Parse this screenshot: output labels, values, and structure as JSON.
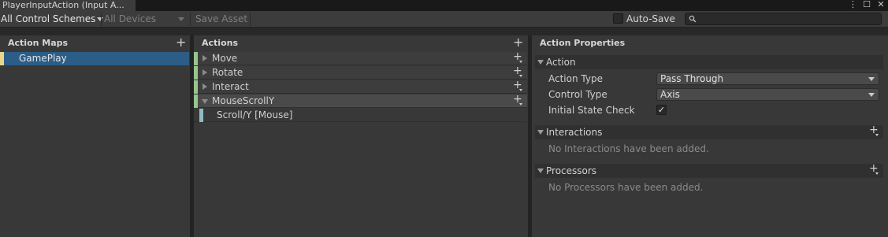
{
  "window": {
    "tab_title": "PlayerInputAction (Input A...",
    "icons": [
      "more-icon",
      "maximize-icon",
      "close-icon"
    ]
  },
  "toolbar": {
    "control_schemes": "All Control Schemes",
    "devices": "All Devices",
    "save_asset": "Save Asset",
    "auto_save_label": "Auto-Save",
    "auto_save_checked": false,
    "search_placeholder": ""
  },
  "action_maps": {
    "header": "Action Maps",
    "items": [
      {
        "label": "GamePlay",
        "selected": true
      }
    ]
  },
  "actions": {
    "header": "Actions",
    "items": [
      {
        "label": "Move",
        "expanded": false
      },
      {
        "label": "Rotate",
        "expanded": false
      },
      {
        "label": "Interact",
        "expanded": false
      },
      {
        "label": "MouseScrollY",
        "expanded": true,
        "selected": true
      }
    ],
    "bindings": [
      {
        "label": "Scroll/Y [Mouse]"
      }
    ]
  },
  "properties": {
    "header": "Action Properties",
    "action_section": "Action",
    "action_type_label": "Action Type",
    "action_type_value": "Pass Through",
    "control_type_label": "Control Type",
    "control_type_value": "Axis",
    "initial_state_label": "Initial State Check",
    "initial_state_checked": true,
    "interactions_section": "Interactions",
    "interactions_empty": "No Interactions have been added.",
    "processors_section": "Processors",
    "processors_empty": "No Processors have been added."
  },
  "colors": {
    "selected_row": "#2c5d87",
    "map_bar": "#e8d78a",
    "action_bar": "#96c58d",
    "binding_bar": "#8fbcc1"
  }
}
